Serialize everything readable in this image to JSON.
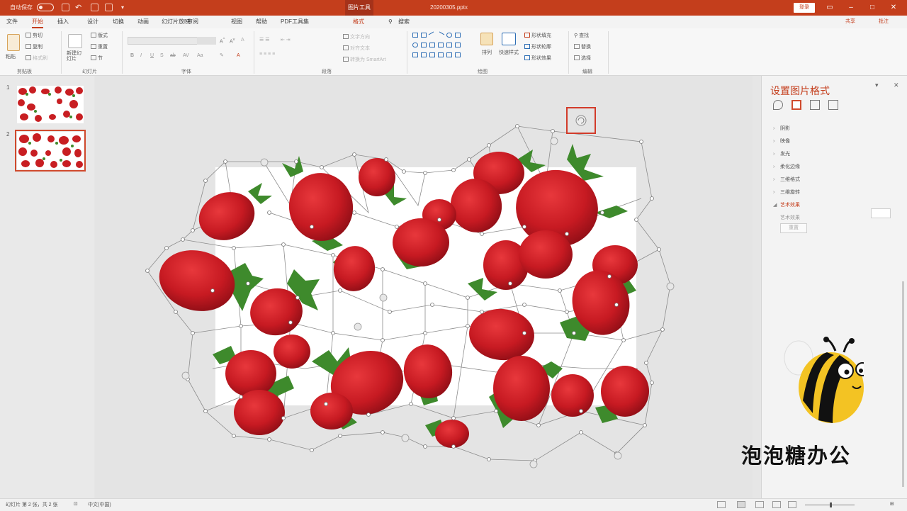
{
  "titlebar": {
    "autosave_label": "自动保存",
    "autosave_state": "关",
    "context_tab": "图片工具",
    "filename": "20200305.pptx",
    "login_label": "登录",
    "accent": "#c43e1c"
  },
  "tabs": [
    "文件",
    "开始",
    "插入",
    "设计",
    "切换",
    "动画",
    "幻灯片放映",
    "审阅",
    "视图",
    "帮助",
    "PDF工具集",
    "格式"
  ],
  "search_label": "搜索",
  "share_label": "共享",
  "comment_label": "批注",
  "ribbon": {
    "clipboard": {
      "paste": "粘贴",
      "cut": "剪切",
      "copy": "复制",
      "format_painter": "格式刷",
      "label": "剪贴板"
    },
    "slides": {
      "new_slide": "新建幻灯片",
      "layout": "版式",
      "reset": "重置",
      "section": "节",
      "label": "幻灯片"
    },
    "font": {
      "label": "字体"
    },
    "paragraph": {
      "text_direction": "文字方向",
      "align_text": "对齐文本",
      "smartart": "转换为 SmartArt",
      "label": "段落"
    },
    "drawing": {
      "arrange": "排列",
      "quick_styles": "快速样式",
      "fill": "形状填充",
      "outline": "形状轮廓",
      "effects": "形状效果",
      "label": "绘图"
    },
    "editing": {
      "find": "查找",
      "replace": "替换",
      "select": "选择",
      "label": "编辑"
    }
  },
  "slides_panel": [
    {
      "number": "1",
      "selected": false
    },
    {
      "number": "2",
      "selected": true
    }
  ],
  "format_pane": {
    "title": "设置图片格式",
    "sections": [
      {
        "label": "阴影",
        "open": false
      },
      {
        "label": "映像",
        "open": false
      },
      {
        "label": "发光",
        "open": false
      },
      {
        "label": "柔化边缘",
        "open": false
      },
      {
        "label": "三维格式",
        "open": false
      },
      {
        "label": "三维旋转",
        "open": false
      },
      {
        "label": "艺术效果",
        "open": true
      }
    ],
    "artistic_effect_label": "艺术效果",
    "reset_label": "重置"
  },
  "statusbar": {
    "slide_info": "幻灯片 第 2 张，共 2 张",
    "language": "中文(中国)"
  },
  "watermark": "泡泡糖办公"
}
